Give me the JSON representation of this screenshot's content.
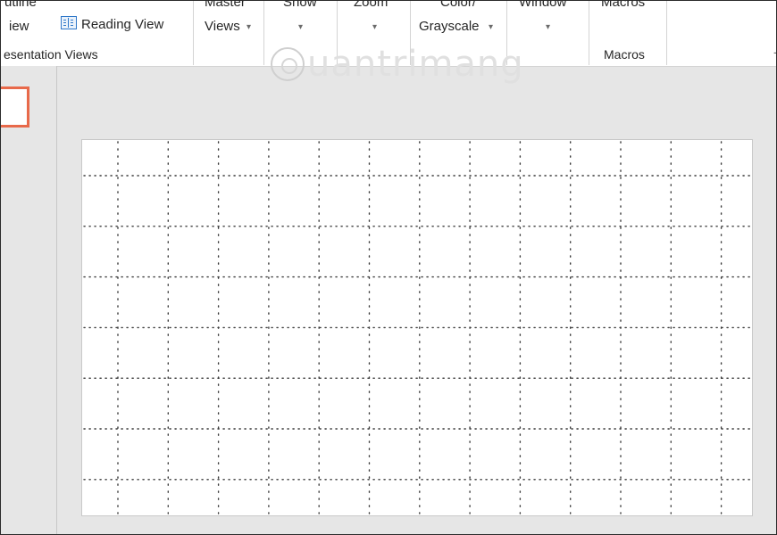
{
  "ribbon": {
    "presentation_views": {
      "outline_view_line1": "utline",
      "outline_view_line2": "iew",
      "reading_view_label": "Reading View",
      "group_label": "esentation Views"
    },
    "master_views": {
      "line1": "Master",
      "line2": "Views"
    },
    "show": {
      "label": "Show"
    },
    "zoom": {
      "label": "Zoom"
    },
    "color_grayscale": {
      "line1": "Color/",
      "line2": "Grayscale"
    },
    "window": {
      "label": "Window"
    },
    "macros": {
      "label": "Macros",
      "group_label": "Macros"
    },
    "dropdown_caret": "▾",
    "collapse_caret": "⌃"
  },
  "watermark": {
    "text": "uantrimang"
  },
  "colors": {
    "selection_border": "#e8694a",
    "reading_view_icon": "#2e77c9",
    "workspace": "#e6e6e6"
  },
  "slide": {
    "gridlines": true,
    "grid_columns": 14,
    "grid_rows": 8
  }
}
